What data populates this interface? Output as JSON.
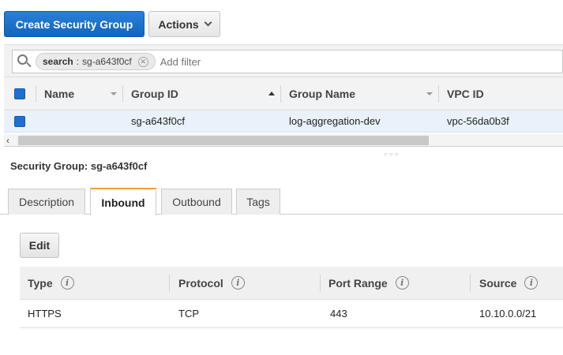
{
  "toolbar": {
    "create_label": "Create Security Group",
    "actions_label": "Actions"
  },
  "filter": {
    "chip_key": "search",
    "chip_sep": ":",
    "chip_value": "sg-a643f0cf",
    "placeholder": "Add filter"
  },
  "grid": {
    "columns": [
      "Name",
      "Group ID",
      "Group Name",
      "VPC ID"
    ],
    "rows": [
      {
        "name": "",
        "group_id": "sg-a643f0cf",
        "group_name": "log-aggregation-dev",
        "vpc_id": "vpc-56da0b3f"
      }
    ]
  },
  "detail": {
    "title": "Security Group: sg-a643f0cf",
    "tabs": [
      "Description",
      "Inbound",
      "Outbound",
      "Tags"
    ],
    "active_tab": "Inbound",
    "edit_label": "Edit",
    "rules_columns": [
      "Type",
      "Protocol",
      "Port Range",
      "Source"
    ],
    "rules": [
      {
        "type": "HTTPS",
        "protocol": "TCP",
        "port_range": "443",
        "source": "10.10.0.0/21"
      }
    ]
  },
  "colors": {
    "primary": "#1a6fc7",
    "active_tab_accent": "#f0a034",
    "selected_row": "#e9f2fb"
  }
}
